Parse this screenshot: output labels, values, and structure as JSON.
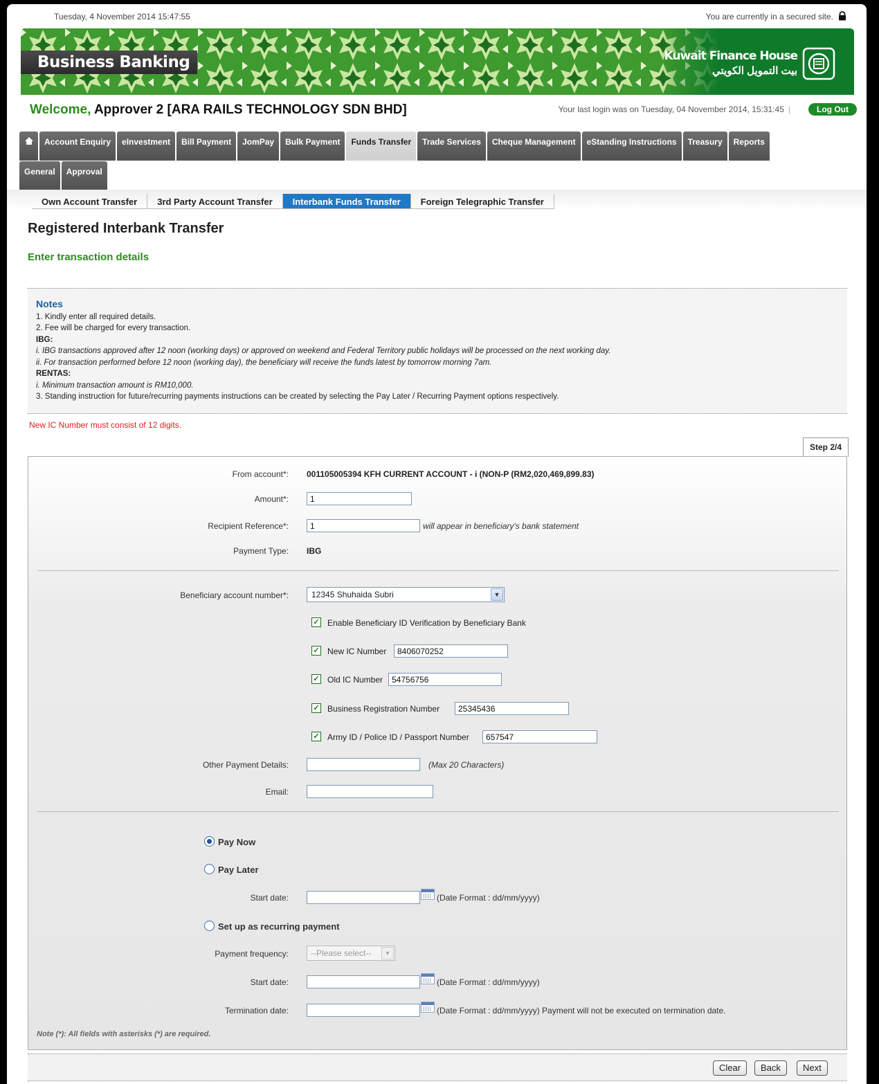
{
  "topbar": {
    "datetime": "Tuesday, 4 November 2014 15:47:55",
    "secure_text": "You are currently in a secured site."
  },
  "banner": {
    "brand": "Business Banking",
    "bank_name_en": "Kuwait Finance House",
    "bank_name_ar": "بيت التمويل الكويتي"
  },
  "header": {
    "welcome_word": "Welcome,",
    "user": "Approver 2 [ARA RAILS TECHNOLOGY SDN BHD]",
    "last_login": "Your last login was on  Tuesday, 04 November 2014, 15:31:45",
    "last_login_sep": "|",
    "logout_label": "Log Out"
  },
  "nav": {
    "tabs": [
      {
        "label": "Account Enquiry"
      },
      {
        "label": "eInvestment"
      },
      {
        "label": "Bill Payment"
      },
      {
        "label": "JomPay"
      },
      {
        "label": "Bulk Payment"
      },
      {
        "label": "Funds Transfer",
        "active": true
      },
      {
        "label": "Trade Services"
      },
      {
        "label": "Cheque Management"
      },
      {
        "label": "eStanding Instructions"
      },
      {
        "label": "Treasury"
      },
      {
        "label": "Reports"
      }
    ],
    "tabs_row2": [
      {
        "label": "General"
      },
      {
        "label": "Approval"
      }
    ],
    "subtabs": [
      {
        "label": "Own Account Transfer"
      },
      {
        "label": "3rd Party Account Transfer"
      },
      {
        "label": "Interbank Funds Transfer",
        "active": true
      },
      {
        "label": "Foreign Telegraphic Transfer"
      }
    ]
  },
  "page": {
    "title": "Registered Interbank Transfer",
    "subtitle": "Enter transaction details",
    "error": "New IC Number must consist of 12 digits.",
    "step": "Step 2/4"
  },
  "notes": {
    "heading": "Notes",
    "line1": "1. Kindly enter all required details.",
    "line2": "2. Fee will be charged for every transaction.",
    "ibg_heading": "IBG:",
    "ibg1": "i. IBG transactions approved after 12 noon (working days) or approved on weekend and Federal Territory public holidays will be processed on the next working day.",
    "ibg2": "ii. For transaction performed before 12 noon (working day), the beneficiary will receive the funds latest by tomorrow morning 7am.",
    "rentas_heading": "RENTAS:",
    "rentas1": "i. Minimum transaction amount is RM10,000.",
    "line3": "3. Standing instruction for future/recurring payments instructions can be created by selecting the Pay Later / Recurring Payment options respectively."
  },
  "form": {
    "from_account_label": "From account*:",
    "from_account_value": "001105005394  KFH CURRENT ACCOUNT - i (NON-P  (RM2,020,469,899.83)",
    "amount_label": "Amount*:",
    "amount_value": "1",
    "recipient_ref_label": "Recipient Reference*:",
    "recipient_ref_value": "1",
    "recipient_ref_hint": "will appear in beneficiary's bank statement",
    "payment_type_label": "Payment Type:",
    "payment_type_value": "IBG",
    "beneficiary_label": "Beneficiary account number*:",
    "beneficiary_value": "12345  Shuhaida Subri",
    "verify_label": "Enable Beneficiary ID Verification by Beneficiary Bank",
    "new_ic_label": "New IC Number",
    "new_ic_value": "8406070252",
    "old_ic_label": "Old IC Number",
    "old_ic_value": "54756756",
    "brn_label": "Business Registration Number",
    "brn_value": "25345436",
    "army_label": "Army ID / Police ID / Passport Number",
    "army_value": "657547",
    "other_details_label": "Other Payment Details:",
    "other_details_value": "",
    "other_details_hint": "(Max 20 Characters)",
    "email_label": "Email:",
    "email_value": "",
    "pay_now_label": "Pay Now",
    "pay_later_label": "Pay Later",
    "start_date_label": "Start date:",
    "date_format_hint": "(Date Format : dd/mm/yyyy)",
    "recurring_label": "Set up as recurring payment",
    "frequency_label": "Payment frequency:",
    "frequency_value": "--Please select--",
    "start_date2_label": "Start date:",
    "termination_label": "Termination date:",
    "termination_hint": "(Date Format : dd/mm/yyyy)  Payment will not be executed on termination date.",
    "required_note": "Note (*): All fields with asterisks (*) are required."
  },
  "buttons": {
    "clear": "Clear",
    "back": "Back",
    "next": "Next"
  },
  "colors": {
    "brand_green": "#2e8b1e",
    "active_subtab": "#1f78c8",
    "error": "#e02020",
    "notes_heading": "#1c5fa5"
  }
}
